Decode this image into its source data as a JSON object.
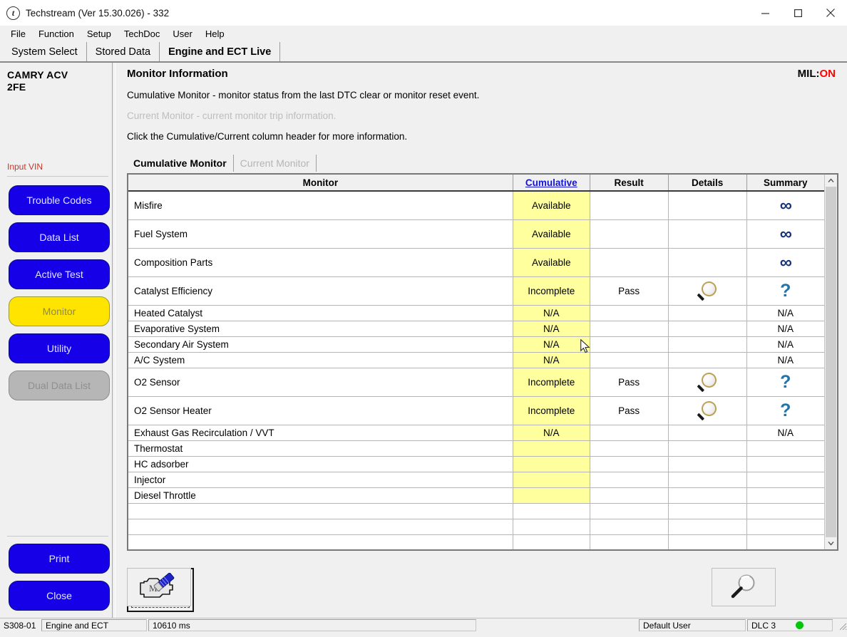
{
  "window": {
    "title": "Techstream (Ver 15.30.026) - 332",
    "logo_letter": "t",
    "minimize_label": "Minimize",
    "maximize_label": "Maximize",
    "close_label": "Close"
  },
  "menu": {
    "items": [
      "File",
      "Function",
      "Setup",
      "TechDoc",
      "User",
      "Help"
    ]
  },
  "top_tabs": [
    {
      "label": "System Select",
      "active": false
    },
    {
      "label": "Stored Data",
      "active": false
    },
    {
      "label": "Engine and ECT Live",
      "active": true
    }
  ],
  "sidebar": {
    "vehicle_line1": "CAMRY ACV",
    "vehicle_line2": "2FE",
    "vin_link": "Input VIN",
    "buttons": [
      {
        "label": "Trouble Codes",
        "state": "normal"
      },
      {
        "label": "Data List",
        "state": "normal"
      },
      {
        "label": "Active Test",
        "state": "normal"
      },
      {
        "label": "Monitor",
        "state": "selected"
      },
      {
        "label": "Utility",
        "state": "normal"
      },
      {
        "label": "Dual Data List",
        "state": "disabled"
      }
    ],
    "bottom_buttons": [
      {
        "label": "Print"
      },
      {
        "label": "Close"
      }
    ]
  },
  "main": {
    "title": "Monitor Information",
    "mil_label": "MIL:",
    "mil_value": "ON",
    "descriptions": [
      {
        "text": "Cumulative Monitor - monitor status from the last DTC clear or monitor reset event.",
        "dim": false
      },
      {
        "text": "Current Monitor - current monitor trip information.",
        "dim": true
      },
      {
        "text": "Click the Cumulative/Current column header for more information.",
        "dim": false
      }
    ],
    "inner_tabs": [
      {
        "label": "Cumulative Monitor",
        "active": true
      },
      {
        "label": "Current Monitor",
        "active": false
      }
    ]
  },
  "table": {
    "headers": [
      "Monitor",
      "Cumulative",
      "Result",
      "Details",
      "Summary"
    ],
    "cumulative_is_link": true,
    "rows": [
      {
        "monitor": "Misfire",
        "cumulative": "Available",
        "result": "",
        "details": "",
        "summary": "infinity",
        "compact": false
      },
      {
        "monitor": "Fuel System",
        "cumulative": "Available",
        "result": "",
        "details": "",
        "summary": "infinity",
        "compact": false
      },
      {
        "monitor": "Composition Parts",
        "cumulative": "Available",
        "result": "",
        "details": "",
        "summary": "infinity",
        "compact": false
      },
      {
        "monitor": "Catalyst Efficiency",
        "cumulative": "Incomplete",
        "result": "Pass",
        "details": "magnifier-icon",
        "summary": "question",
        "compact": false
      },
      {
        "monitor": "Heated Catalyst",
        "cumulative": "N/A",
        "result": "",
        "details": "",
        "summary": "N/A",
        "compact": true
      },
      {
        "monitor": "Evaporative System",
        "cumulative": "N/A",
        "result": "",
        "details": "",
        "summary": "N/A",
        "compact": true
      },
      {
        "monitor": "Secondary Air System",
        "cumulative": "N/A",
        "result": "",
        "details": "",
        "summary": "N/A",
        "compact": true
      },
      {
        "monitor": "A/C System",
        "cumulative": "N/A",
        "result": "",
        "details": "",
        "summary": "N/A",
        "compact": true
      },
      {
        "monitor": "O2 Sensor",
        "cumulative": "Incomplete",
        "result": "Pass",
        "details": "magnifier-icon",
        "summary": "question",
        "compact": false
      },
      {
        "monitor": "O2 Sensor Heater",
        "cumulative": "Incomplete",
        "result": "Pass",
        "details": "magnifier-icon",
        "summary": "question",
        "compact": false
      },
      {
        "monitor": "Exhaust Gas Recirculation / VVT",
        "cumulative": "N/A",
        "result": "",
        "details": "",
        "summary": "N/A",
        "compact": true
      },
      {
        "monitor": "Thermostat",
        "cumulative": "",
        "result": "",
        "details": "",
        "summary": "",
        "compact": true
      },
      {
        "monitor": "HC adsorber",
        "cumulative": "",
        "result": "",
        "details": "",
        "summary": "",
        "compact": true
      },
      {
        "monitor": "Injector",
        "cumulative": "",
        "result": "",
        "details": "",
        "summary": "",
        "compact": true
      },
      {
        "monitor": "Diesel Throttle",
        "cumulative": "",
        "result": "",
        "details": "",
        "summary": "",
        "compact": true
      }
    ],
    "blank_row_count": 4,
    "scrollbar": {
      "up_arrow": "chevron-up-icon",
      "down_arrow": "chevron-down-icon"
    }
  },
  "bottom_toolbar": {
    "mil_button": "mil-check-engine-icon",
    "find_button": "magnifier-icon",
    "save_button": "floppy-disk-save-icon"
  },
  "statusbar": {
    "screen_id": "S308-01",
    "system": "Engine and ECT",
    "timing": "10610 ms",
    "user": "Default User",
    "connector": "DLC 3",
    "link_status": "connected"
  },
  "colors": {
    "accent_blue": "#1500e8",
    "selected_yellow": "#ffe400",
    "cell_yellow": "#ffff9e",
    "mil_red": "#ff0000",
    "link_blue": "#1414d0",
    "status_green": "#00c806"
  }
}
